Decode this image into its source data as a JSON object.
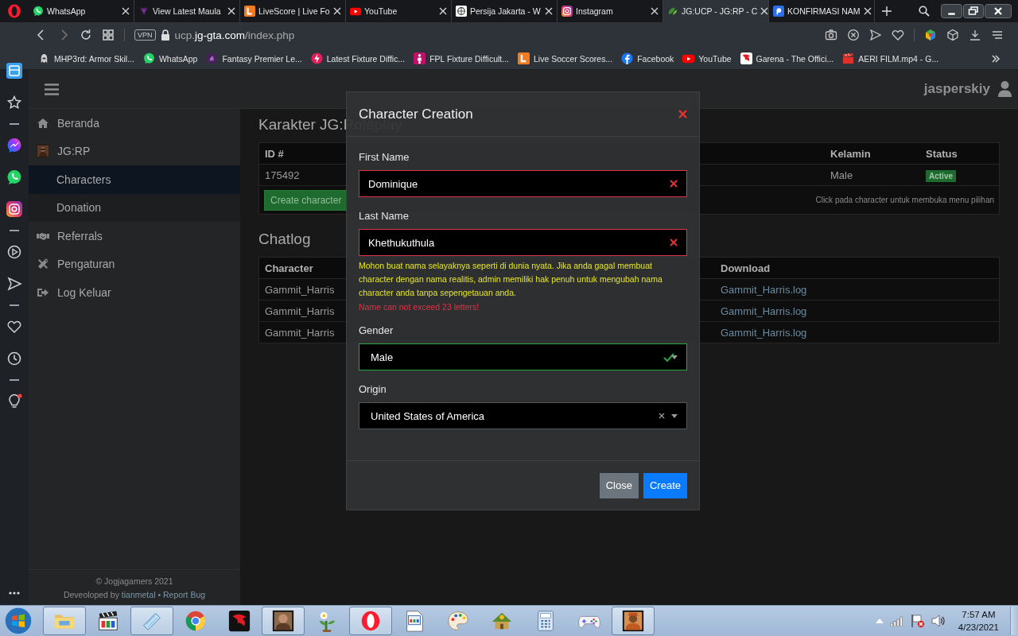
{
  "browser": {
    "tabs": [
      {
        "title": "WhatsApp",
        "kind": "whatsapp",
        "selected": false
      },
      {
        "title": "View Latest Maula",
        "kind": "purple",
        "selected": false
      },
      {
        "title": "LiveScore | Live Fo",
        "kind": "livescore",
        "selected": false
      },
      {
        "title": "YouTube",
        "kind": "youtube",
        "selected": false
      },
      {
        "title": "Persija Jakarta - W",
        "kind": "wiki",
        "selected": false
      },
      {
        "title": "Instagram",
        "kind": "instagram",
        "selected": false
      },
      {
        "title": "JG:UCP - JG:RP - C",
        "kind": "jg",
        "selected": true
      },
      {
        "title": "KONFIRMASI NAM",
        "kind": "konfirmasi",
        "selected": false
      }
    ],
    "address_bar": {
      "vpn": "VPN",
      "url": "ucp.**jg-gta.com**/index.php"
    },
    "bookmarks": [
      {
        "label": "MHP3rd: Armor Skil...",
        "kind": "armor"
      },
      {
        "label": "WhatsApp",
        "kind": "whatsapp"
      },
      {
        "label": "Fantasy Premier Le...",
        "kind": "premier"
      },
      {
        "label": "Latest Fixture Diffic...",
        "kind": "fixture"
      },
      {
        "label": "FPL Fixture Difficult...",
        "kind": "fpl"
      },
      {
        "label": "Live Soccer Scores...",
        "kind": "livescore"
      },
      {
        "label": "Facebook",
        "kind": "facebook"
      },
      {
        "label": "YouTube",
        "kind": "youtube"
      },
      {
        "label": "Garena - The Offici...",
        "kind": "garena"
      },
      {
        "label": "AERI FILM.mp4 - G...",
        "kind": "film"
      }
    ]
  },
  "opera_sidebar": {
    "items": [
      {
        "kind": "home",
        "notification": false
      },
      {
        "kind": "star",
        "notification": false
      },
      {
        "kind": "divider"
      },
      {
        "kind": "messenger",
        "notification": false
      },
      {
        "kind": "whatsapp",
        "notification": false
      },
      {
        "kind": "instagram",
        "notification": false
      },
      {
        "kind": "divider"
      },
      {
        "kind": "player",
        "notification": false
      },
      {
        "kind": "send",
        "notification": false
      },
      {
        "kind": "divider"
      },
      {
        "kind": "heart",
        "notification": false
      },
      {
        "kind": "clock",
        "notification": false
      },
      {
        "kind": "divider"
      },
      {
        "kind": "bulb",
        "notification": true
      }
    ]
  },
  "header": {
    "username": "jasperskiy"
  },
  "sidebar": {
    "menu": [
      {
        "label": "Beranda",
        "kind": "home",
        "selected": false
      },
      {
        "label": "JG:RP",
        "kind": "game",
        "selected": false,
        "children": [
          {
            "label": "Characters",
            "selected": true
          },
          {
            "label": "Donation",
            "selected": false
          }
        ]
      },
      {
        "label": "Referrals",
        "kind": "handshake",
        "selected": false
      },
      {
        "label": "Pengaturan",
        "kind": "tools",
        "selected": false
      },
      {
        "label": "Log Keluar",
        "kind": "logout",
        "selected": false
      }
    ],
    "footer": {
      "copyright": "© Jogjagamers 2021",
      "credit": "Deveoloped by",
      "author": "tianmetal",
      "separator": "•",
      "report": "Report Bug"
    }
  },
  "characters": {
    "title": "Karakter JG:Roleplay",
    "columns": [
      {
        "label": "ID #",
        "kind": "text"
      },
      {
        "label": "Kelamin",
        "kind": "text"
      },
      {
        "label": "Status",
        "kind": "badge"
      }
    ],
    "rows": [
      {
        "cells": [
          "175492",
          "Male",
          "Active"
        ]
      }
    ],
    "create_button": "Create character",
    "hint": "Click pada character untuk membuka menu pilihan"
  },
  "chatlog": {
    "title": "Chatlog",
    "columns": [
      {
        "label": "Character",
        "kind": "text"
      },
      {
        "label": "Download",
        "kind": "link"
      }
    ],
    "rows": [
      {
        "cells": [
          "Gammit_Harris",
          "Gammit_Harris.log"
        ]
      },
      {
        "cells": [
          "Gammit_Harris",
          "Gammit_Harris.log"
        ]
      },
      {
        "cells": [
          "Gammit_Harris",
          "Gammit_Harris.log"
        ]
      }
    ]
  },
  "modal": {
    "title": "Character Creation",
    "fields": [
      {
        "label": "First Name",
        "kind": "text",
        "value": "Dominique",
        "invalid": true,
        "valid": false
      },
      {
        "label": "Last Name",
        "kind": "text",
        "value": "Khethukuthula",
        "invalid": true,
        "valid": false,
        "help": "Mohon buat nama selayaknya seperti di dunia nyata. Jika anda gagal membuat character dengan nama realitis, admin memiliki hak penuh untuk mengubah nama character anda tanpa sepengetauan anda.",
        "error": "Name can not exceed 23 letters!"
      },
      {
        "label": "Gender",
        "kind": "select",
        "value": "Male",
        "invalid": false,
        "valid": true
      },
      {
        "label": "Origin",
        "kind": "select",
        "value": "United States of America",
        "invalid": false,
        "valid": false,
        "clearable": true
      }
    ],
    "buttons": [
      {
        "label": "Close",
        "kind": "secondary"
      },
      {
        "label": "Create",
        "kind": "primary"
      }
    ]
  },
  "taskbar": {
    "apps": [
      {
        "kind": "folder",
        "open": true
      },
      {
        "kind": "clapper",
        "open": false
      },
      {
        "kind": "notepad",
        "open": true
      },
      {
        "kind": "chrome",
        "open": false
      },
      {
        "kind": "garena",
        "open": false
      },
      {
        "kind": "figure",
        "open": true
      },
      {
        "kind": "flower",
        "open": false
      },
      {
        "kind": "opera",
        "open": true
      },
      {
        "kind": "document",
        "open": false
      },
      {
        "kind": "palette",
        "open": false
      },
      {
        "kind": "hut",
        "open": false
      },
      {
        "kind": "calculator",
        "open": false
      },
      {
        "kind": "gamepad",
        "open": false
      },
      {
        "kind": "figure2",
        "open": true
      }
    ],
    "time": "7:57 AM",
    "date": "4/23/2021"
  }
}
